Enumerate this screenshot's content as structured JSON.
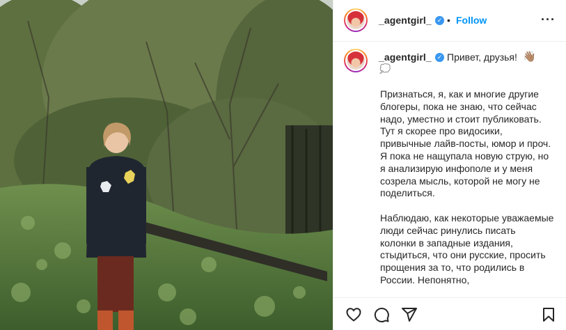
{
  "post": {
    "author": "_agentgirl_",
    "follow_label": "Follow",
    "separator": "•",
    "more_icon": "more-options-icon",
    "verified_mark": "✓",
    "caption_greeting": "Привет, друзья!",
    "greeting_emoji": "👋🏽",
    "sparkle_emoji": "💭",
    "caption_text": "Признаться, я, как и многие другие блогеры, пока не знаю, что сейчас надо, уместно и стоит публиковать. Тут я скорее про видосики, привычные лайв-посты, юмор и проч. Я пока не нащупала новую струю, но я анализирую инфополе и у меня созрела мысль, которой не могу не поделиться.\n\nНаблюдаю, как некоторые уважаемые люди сейчас ринулись писать колонки в западные издания, стыдиться, что они русские, просить прощения за то, что родились в России. Непонятно,"
  },
  "actions": {
    "like_icon": "heart-icon",
    "comment_icon": "comment-icon",
    "share_icon": "share-icon",
    "save_icon": "bookmark-icon"
  },
  "colors": {
    "accent": "#0095f6",
    "verified": "#3897f0",
    "text": "#262626"
  }
}
